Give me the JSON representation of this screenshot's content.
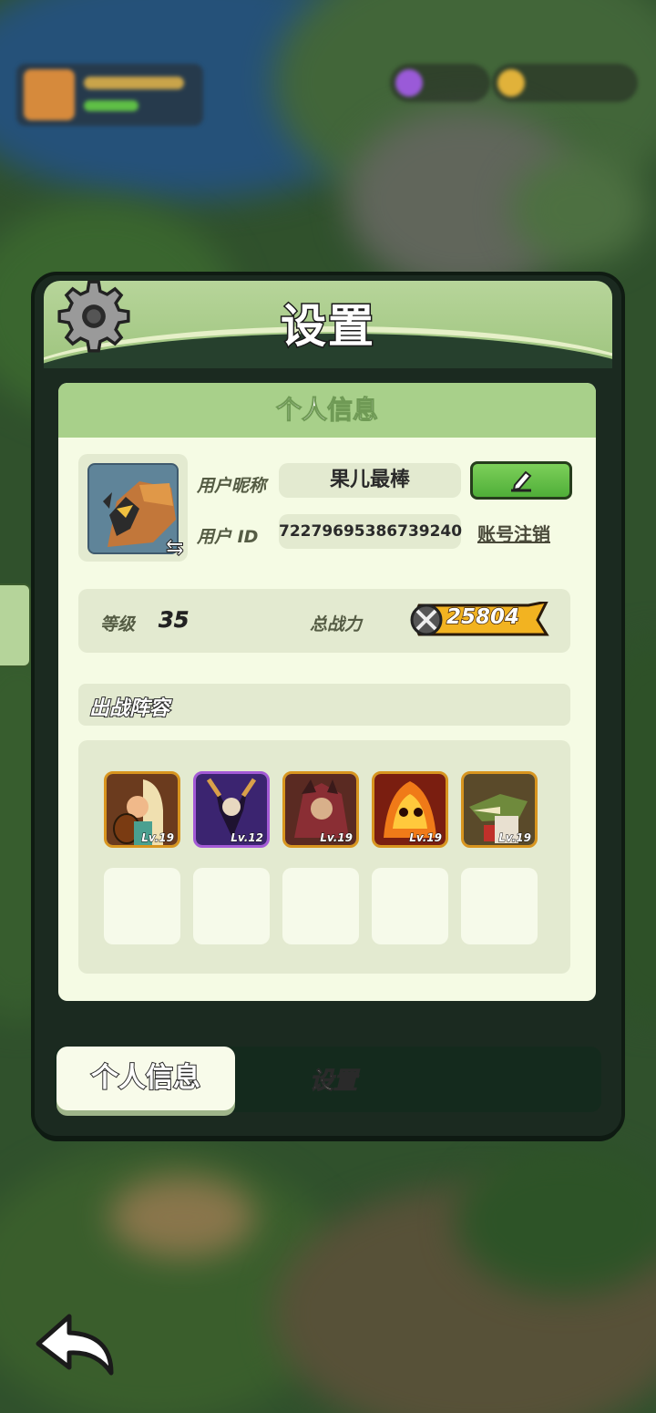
{
  "dialog": {
    "title": "设置",
    "section_title": "个人信息",
    "nickname_label": "用户昵称",
    "nickname": "果儿最棒",
    "id_label": "用户 ID",
    "user_id": "72279695386739240",
    "cancel_account": "账号注销",
    "level_label": "等级",
    "level": "35",
    "power_label": "总战力",
    "power": "25804",
    "team_title": "出战阵容",
    "heroes": [
      {
        "level": "Lv.19",
        "rarity_color": "#d8951f"
      },
      {
        "level": "Lv.12",
        "rarity_color": "#a35ad6"
      },
      {
        "level": "Lv.19",
        "rarity_color": "#d8951f"
      },
      {
        "level": "Lv.19",
        "rarity_color": "#d8951f"
      },
      {
        "level": "Lv.19",
        "rarity_color": "#d8951f"
      }
    ],
    "tabs": {
      "personal": "个人信息",
      "settings": "设置"
    }
  },
  "colors": {
    "accent_green": "#a8d08a",
    "panel_dark": "#1b2a20",
    "card_bg": "#f5fbe4"
  },
  "icons": {
    "settings": "gear-icon",
    "edit": "pencil-icon",
    "back": "back-arrow-icon",
    "power": "crossed-swords-icon"
  }
}
